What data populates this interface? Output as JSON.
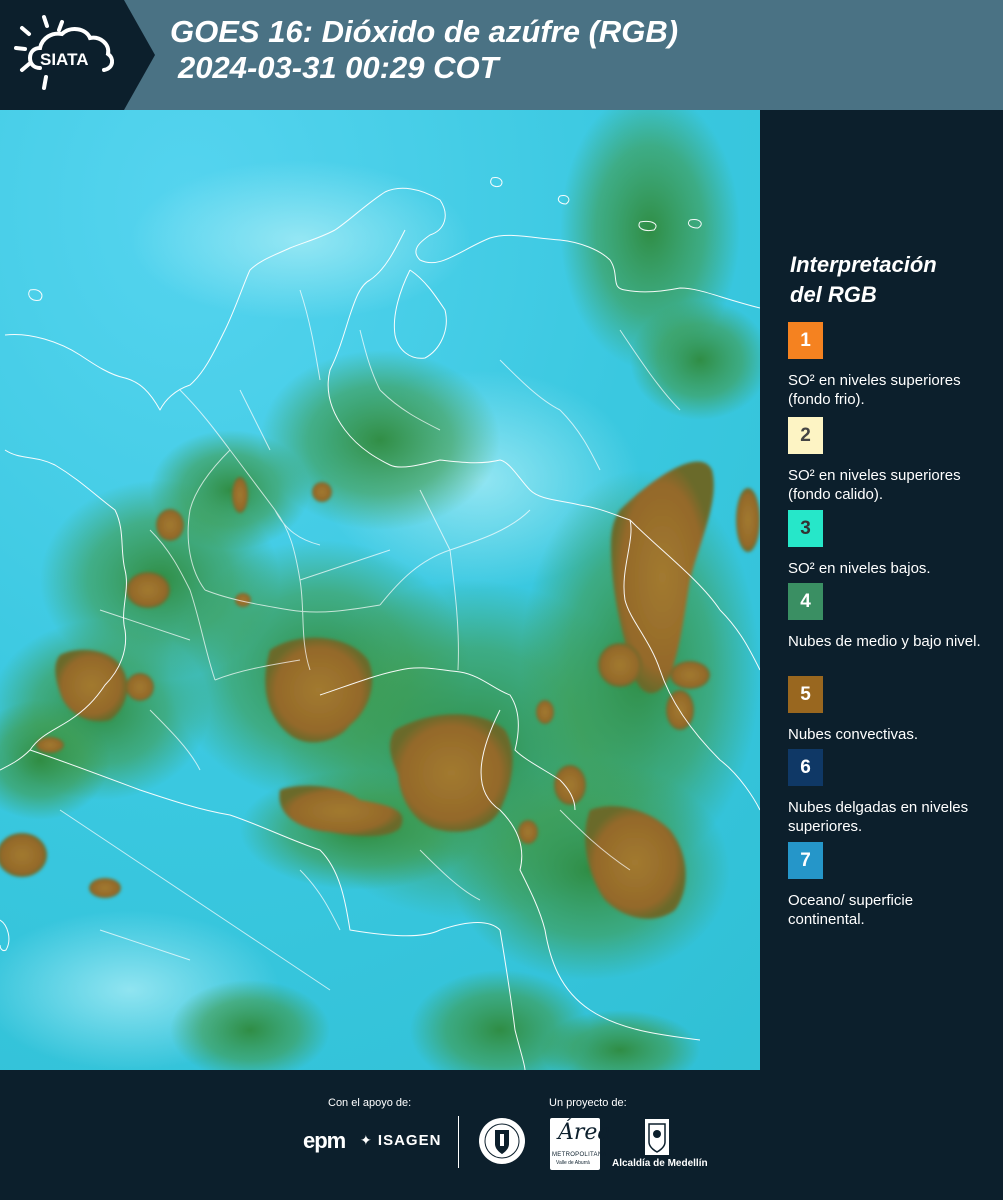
{
  "header": {
    "logo_text": "SIATA",
    "title_line1": "GOES 16: Dióxido de azúfre (RGB)",
    "title_line2": "2024-03-31 00:29 COT"
  },
  "legend": {
    "title_line1": "Interpretación",
    "title_line2": "del RGB",
    "items": [
      {
        "number": "1",
        "text": "SO² en niveles superiores (fondo frio).",
        "color": "#f58220",
        "num_color": "#ffffff"
      },
      {
        "number": "2",
        "text": "SO² en niveles superiores (fondo calido).",
        "color": "#fdf4c4",
        "num_color": "#444444"
      },
      {
        "number": "3",
        "text": "SO² en niveles bajos.",
        "color": "#26e7c9",
        "num_color": "#333333"
      },
      {
        "number": "4",
        "text": "Nubes de medio y bajo nivel.",
        "color": "#3a8f63",
        "num_color": "#ffffff"
      },
      {
        "number": "5",
        "text": "Nubes convectivas.",
        "color": "#99671f",
        "num_color": "#ffffff"
      },
      {
        "number": "6",
        "text": "Nubes delgadas en niveles superiores.",
        "color": "#0f3866",
        "num_color": "#ffffff"
      },
      {
        "number": "7",
        "text": "Oceano/ superficie continental.",
        "color": "#2596c9",
        "num_color": "#ffffff"
      }
    ]
  },
  "footer": {
    "support_label": "Con el apoyo de:",
    "project_label": "Un proyecto de:",
    "epm_text": "epm",
    "isagen_text": "ISAGEN",
    "area_text": "Área",
    "area_sub1": "METROPOLITANA",
    "area_sub2": "Valle de Aburrá",
    "alcaldia_text": "Alcaldía de Medellín"
  },
  "colors": {
    "background": "#0c1f2c",
    "header_band": "#4a7284",
    "ocean_cyan": "#38c8e0",
    "convective_brown": "#9a7028",
    "mid_cloud_green": "#3f9a4a"
  }
}
